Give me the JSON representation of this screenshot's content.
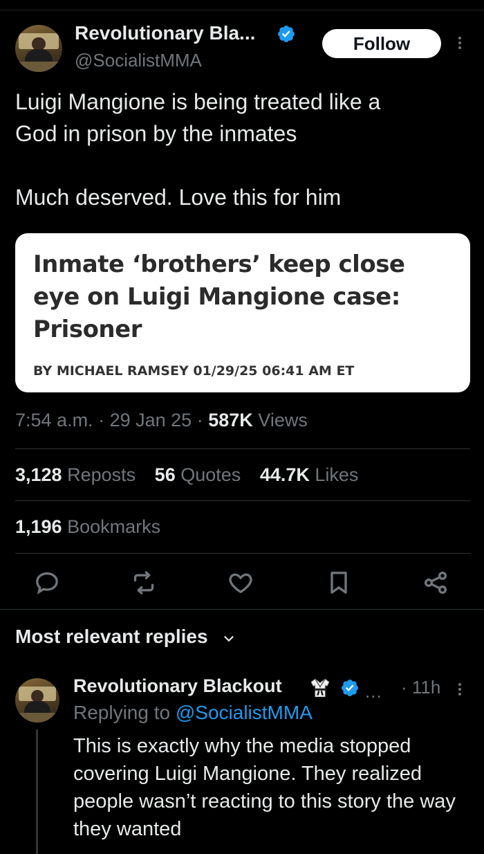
{
  "tweet": {
    "author": {
      "display_name": "Revolutionary Bla...",
      "handle": "@SocialistMMA",
      "verified": true,
      "avatar": "avatar-photo"
    },
    "follow_label": "Follow",
    "text_lines": [
      "Luigi Mangione is being treated like a",
      "God in prison by the inmates",
      "Much deserved. Love this for him"
    ],
    "card": {
      "headline": "Inmate ‘brothers’ keep close eye on Luigi Mangione case: Prisoner",
      "byline": "BY MICHAEL RAMSEY 01/29/25 06:41 AM ET"
    },
    "meta": {
      "time": "7:54 a.m.",
      "sep1": "·",
      "date": "29 Jan 25",
      "sep2": "·",
      "views_count": "587K",
      "views_label": "Views"
    },
    "stats": {
      "reposts_count": "3,128",
      "reposts_label": "Reposts",
      "quotes_count": "56",
      "quotes_label": "Quotes",
      "likes_count": "44.7K",
      "likes_label": "Likes",
      "bookmarks_count": "1,196",
      "bookmarks_label": "Bookmarks"
    },
    "actions": [
      "reply-icon",
      "repost-icon",
      "like-icon",
      "bookmark-icon",
      "share-icon"
    ]
  },
  "replies": {
    "header": "Most relevant replies",
    "items": [
      {
        "display_name": "Revolutionary Blackout",
        "name_emoji": "martial-arts-uniform-icon",
        "verified": true,
        "ellipsis": "...",
        "time": "· 11h",
        "replying_prefix": "Replying to",
        "replying_handle": "@SocialistMMA",
        "text": "This is exactly why the media stopped covering Luigi Mangione. They realized people wasn’t reacting to this story the way they wanted"
      }
    ]
  },
  "colors": {
    "background": "#000000",
    "text": "#e7e9ea",
    "muted": "#71767b",
    "accent": "#1d9bf0",
    "divider": "#2f3336"
  }
}
